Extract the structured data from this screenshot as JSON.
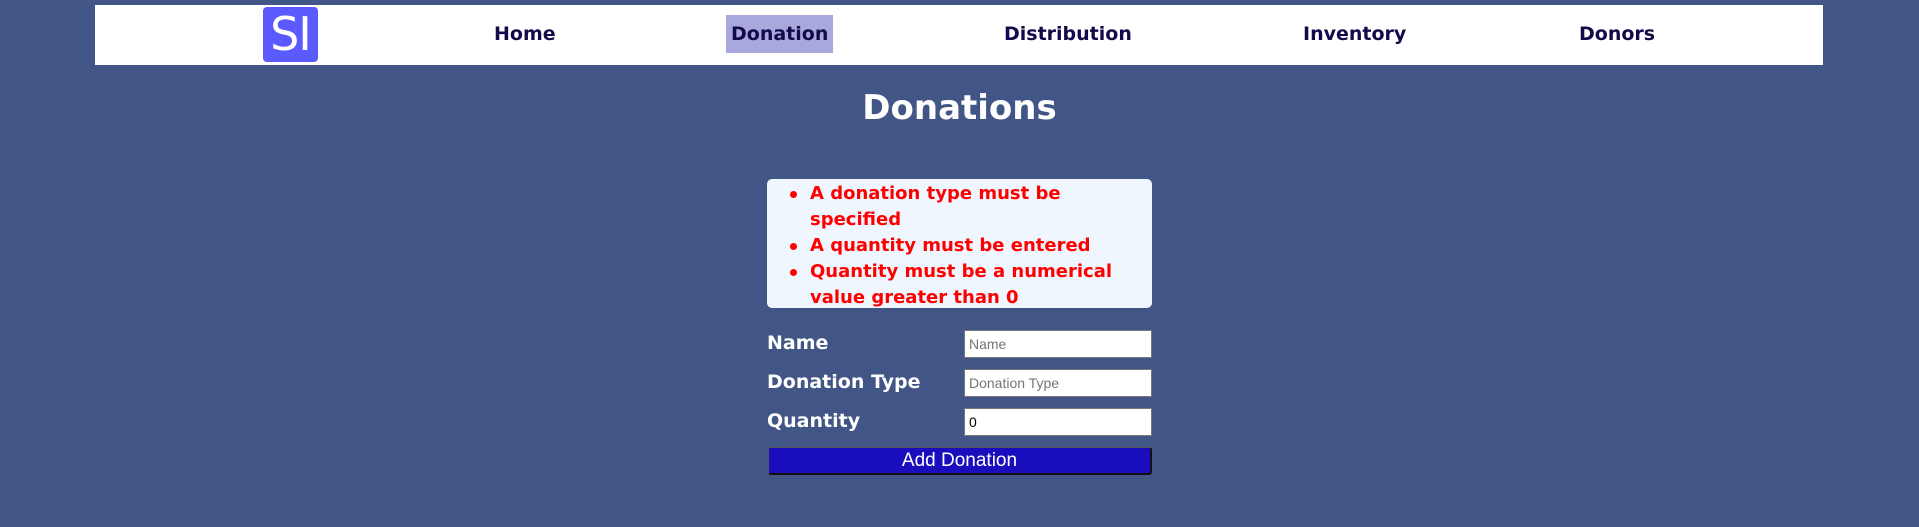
{
  "navbar": {
    "logo_text": "SI",
    "items": [
      {
        "label": "Home",
        "active": false
      },
      {
        "label": "Donation",
        "active": true
      },
      {
        "label": "Distribution",
        "active": false
      },
      {
        "label": "Inventory",
        "active": false
      },
      {
        "label": "Donors",
        "active": false
      }
    ]
  },
  "page": {
    "title": "Donations"
  },
  "errors": [
    "A donation type must be specified",
    "A quantity must be entered",
    "Quantity must be a numerical value greater than 0"
  ],
  "form": {
    "name": {
      "label": "Name",
      "placeholder": "Name",
      "value": ""
    },
    "donation_type": {
      "label": "Donation Type",
      "placeholder": "Donation Type",
      "value": ""
    },
    "quantity": {
      "label": "Quantity",
      "placeholder": "",
      "value": "0"
    },
    "submit_label": "Add Donation"
  },
  "colors": {
    "background": "#415587",
    "nav_active": "#a8a8dd",
    "nav_text": "#120a4a",
    "logo_bg": "#5a5aff",
    "error_text": "#ff0000",
    "error_bg": "#eff6fd",
    "button_bg": "#1a0dbd"
  }
}
